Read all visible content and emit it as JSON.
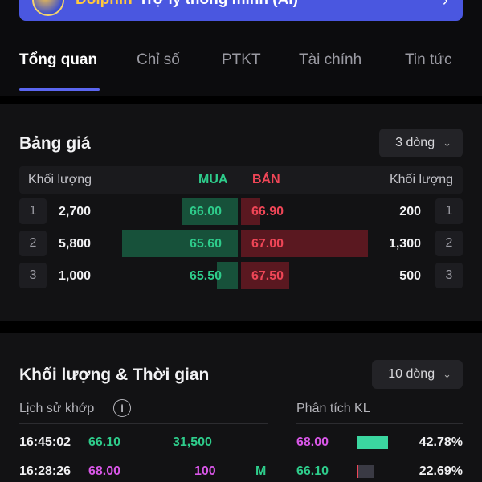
{
  "banner": {
    "brand": "Dolphin",
    "tagline": "Trợ lý thông minh (AI)",
    "chevron": "›"
  },
  "tabs": [
    {
      "label": "Tổng quan",
      "active": true
    },
    {
      "label": "Chỉ số"
    },
    {
      "label": "PTKT"
    },
    {
      "label": "Tài chính"
    },
    {
      "label": "Tin tức"
    }
  ],
  "price_board": {
    "title": "Bảng giá",
    "dropdown": "3 dòng",
    "headers": {
      "buy_volume": "Khối lượng",
      "buy": "MUA",
      "sell": "BÁN",
      "sell_volume": "Khối lượng"
    },
    "rows": [
      {
        "idx": "1",
        "buy_vol": "2,700",
        "buy_price": "66.00",
        "sell_price": "66.90",
        "sell_vol": "200",
        "sell_idx": "1",
        "buy_depth": 0.48,
        "sell_depth": 0.15
      },
      {
        "idx": "2",
        "buy_vol": "5,800",
        "buy_price": "65.60",
        "sell_price": "67.00",
        "sell_vol": "1,300",
        "sell_idx": "2",
        "buy_depth": 1.0,
        "sell_depth": 1.0
      },
      {
        "idx": "3",
        "buy_vol": "1,000",
        "buy_price": "65.50",
        "sell_price": "67.50",
        "sell_vol": "500",
        "sell_idx": "3",
        "buy_depth": 0.18,
        "sell_depth": 0.38
      }
    ]
  },
  "volume_time": {
    "title": "Khối lượng & Thời gian",
    "dropdown": "10 dòng",
    "history_label": "Lịch sử khớp",
    "info_icon": "i",
    "analysis_label": "Phân tích KL",
    "trades": [
      {
        "time": "16:45:02",
        "price": "66.10",
        "volume": "31,500",
        "side": ""
      },
      {
        "time": "16:28:26",
        "price": "68.00",
        "volume": "100",
        "side": "M"
      }
    ],
    "analysis": [
      {
        "price": "68.00",
        "pct": "42.78%",
        "share": 0.4278,
        "color": "#3bd6a0"
      },
      {
        "price": "66.10",
        "pct": "22.69%",
        "share": 0.2269,
        "color": "#3a3a44"
      }
    ]
  },
  "colors": {
    "accent": "#5b66f0",
    "buy": "#2ecc8b",
    "sell": "#ef4657",
    "ceiling": "#d957e8"
  }
}
